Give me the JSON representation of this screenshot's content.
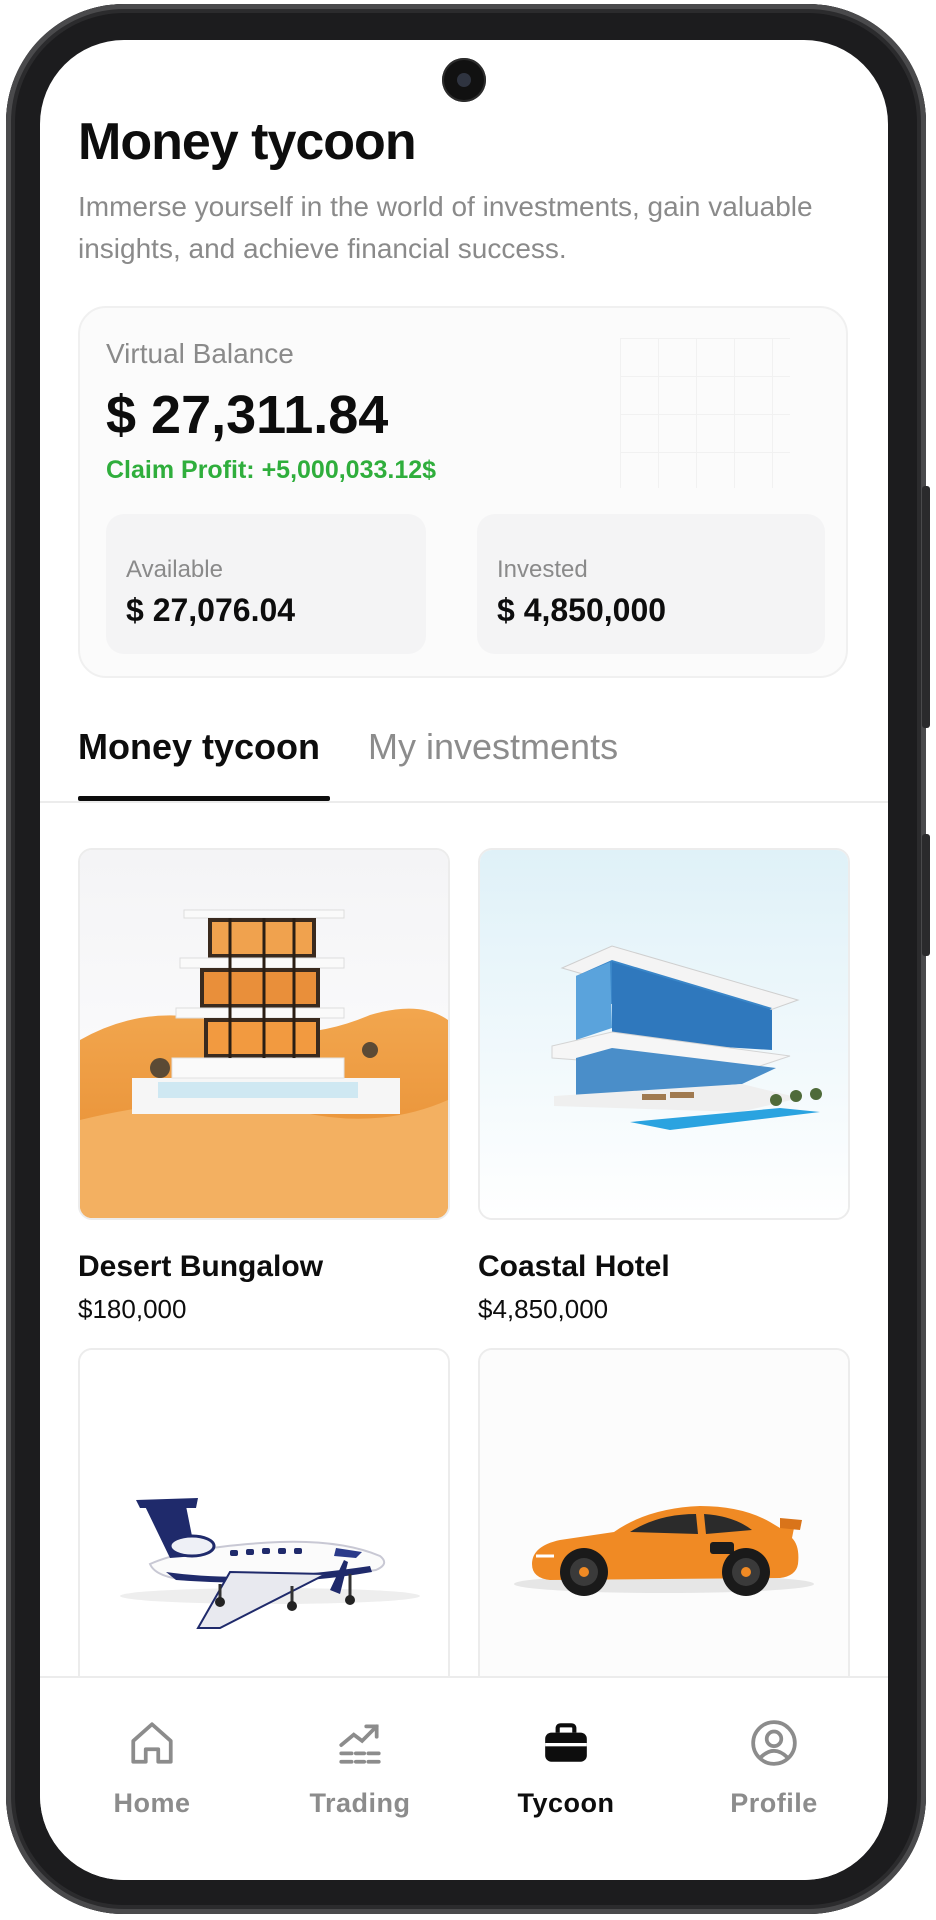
{
  "header": {
    "title": "Money tycoon",
    "subtitle": "Immerse yourself in the world of investments, gain valuable insights, and achieve financial success."
  },
  "balance": {
    "label": "Virtual Balance",
    "amount": "$ 27,311.84",
    "profit": "Claim Profit: +5,000,033.12$",
    "available_label": "Available",
    "available_value": "$ 27,076.04",
    "invested_label": "Invested",
    "invested_value": "$ 4,850,000"
  },
  "tabs": [
    {
      "label": "Money tycoon",
      "active": true
    },
    {
      "label": "My investments",
      "active": false
    }
  ],
  "items": [
    {
      "name": "Desert Bungalow",
      "price": "$180,000",
      "image": "desert-bungalow-image"
    },
    {
      "name": "Coastal Hotel",
      "price": "$4,850,000",
      "image": "coastal-hotel-image"
    },
    {
      "name": "",
      "price": "",
      "image": "private-jet-image"
    },
    {
      "name": "",
      "price": "",
      "image": "sports-car-image"
    }
  ],
  "nav": [
    {
      "label": "Home",
      "icon": "home-icon",
      "active": false
    },
    {
      "label": "Trading",
      "icon": "trading-icon",
      "active": false
    },
    {
      "label": "Tycoon",
      "icon": "briefcase-icon",
      "active": true
    },
    {
      "label": "Profile",
      "icon": "profile-icon",
      "active": false
    }
  ],
  "colors": {
    "profit_green": "#2fae3c",
    "text_primary": "#0d0d0d",
    "text_muted": "#8a8a8a",
    "sand_orange": "#f0a14a",
    "car_orange": "#f08a24",
    "jet_navy": "#1f2a6b"
  }
}
